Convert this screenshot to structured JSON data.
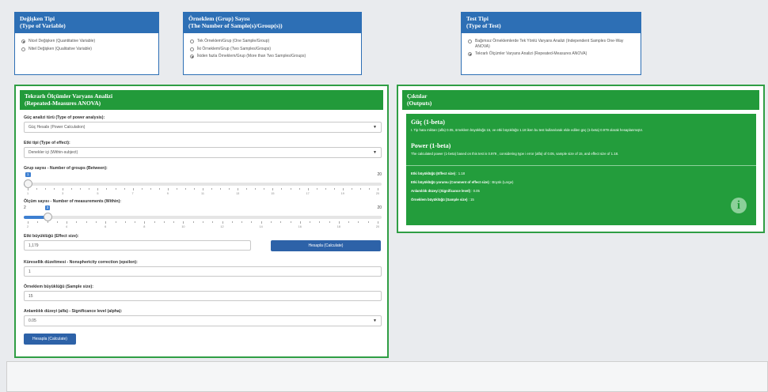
{
  "variable_type": {
    "title1": "Değişken Tipi",
    "title2": "(Type of Variable)",
    "options": [
      {
        "label": "Nicel Değişken (Quantitative Variable)",
        "selected": true
      },
      {
        "label": "Nitel Değişken (Qualitative Variable)",
        "selected": false
      }
    ]
  },
  "sample_count": {
    "title1": "Örneklem (Grup) Sayısı",
    "title2": "(The Number of Sample(s)/Group(s))",
    "options": [
      {
        "label": "Tek Örneklem/Grup (One Sample/Group)",
        "selected": false
      },
      {
        "label": "İki Örneklem/Grup (Two Samples/Groups)",
        "selected": false
      },
      {
        "label": "İkiden fazla Örneklem/Grup (More than Two Samples/Groups)",
        "selected": true
      }
    ]
  },
  "test_type": {
    "title1": "Test Tipi",
    "title2": "(Type of Test)",
    "options": [
      {
        "label": "Bağımsız Örneklemlerde Tek Yönlü Varyans Analizi (Independent Samples One-Way ANOVA)",
        "selected": false
      },
      {
        "label": "Tekrarlı Ölçümler Varyans Analizi (Repeated-Measures ANOVA)",
        "selected": true
      }
    ]
  },
  "anova_panel": {
    "title1": "Tekrarlı Ölçümler Varyans Analizi",
    "title2": "(Repeated-Measures ANOVA)",
    "power_type_label": "Güç analizi türü (Type of power analysis):",
    "power_type_value": "Güç Hesabı (Power Calculation)",
    "effect_type_label": "Etki tipi (Type of effect):",
    "effect_type_value": "Denekler içi (Within-subject)",
    "groups_label": "Grup sayısı - Number of groups (Between):",
    "groups_slider": {
      "min": "1",
      "max": "20",
      "value": "1",
      "level": 0.0,
      "ticks": [
        "1",
        "3",
        "5",
        "7",
        "9",
        "11",
        "13",
        "15",
        "17",
        "19",
        "20"
      ]
    },
    "measurements_label": "Ölçüm sayısı - Number of measurements (Within):",
    "measurements_slider": {
      "min": "2",
      "max": "20",
      "value": "3",
      "level": 0.056,
      "ticks": [
        "2",
        "4",
        "6",
        "8",
        "10",
        "12",
        "14",
        "16",
        "18",
        "20"
      ]
    },
    "effect_size_label": "Etki büyüklüğü (Effect size):",
    "effect_size_value": "1,179",
    "calc_button_1": "Hesapla (Calculate)",
    "epsilon_label": "Küresellik düzeltmesi - Nonsphericity correction (epsilon):",
    "epsilon_value": "1",
    "sample_size_label": "Örneklem büyüklüğü (Sample size):",
    "sample_size_value": "15",
    "alpha_label": "Anlamlılık düzeyi (alfa) - Significance level (alpha):",
    "alpha_value": "0.05",
    "calc_button_2": "Hesapla (Calculate)"
  },
  "outputs": {
    "title1": "Çıktılar",
    "title2": "(Outputs)",
    "tr_heading": "Güç (1-beta)",
    "tr_text": "I. Tip hata miktarı (alfa) 0.05, örneklem büyüklüğü 15, ve etki büyüklüğü 1.18 iken bu test kullanılarak elde edilen güç (1-beta) 0.979 olarak hesaplanmıştır.",
    "en_heading": "Power (1-beta)",
    "en_text": "The calculated power (1-beta) based on this test is 0.979 , considering type i error (alfa) of 0.05, sample size of 15, and effect size of 1.18.",
    "effect_size_key": "Etki büyüklüğü (Effect size)",
    "effect_size_val": " : 1.18",
    "comment_key": "Etki büyüklüğü yorumu (Comment of effect size)",
    "comment_val": " : Büyük (Large)",
    "significance_key": "Anlamlılık düzeyi (Significance level)",
    "significance_val": " : 0.05",
    "sample_key": "Örneklem büyüklüğü (Sample size)",
    "sample_val": " : 15",
    "info_icon": "i"
  },
  "colors": {
    "blue_header": "#2d6fb5",
    "green_header": "#229a3a",
    "output_green": "#239d3c",
    "button_blue": "#2d62a8",
    "slider_blue": "#3d7fd1"
  }
}
